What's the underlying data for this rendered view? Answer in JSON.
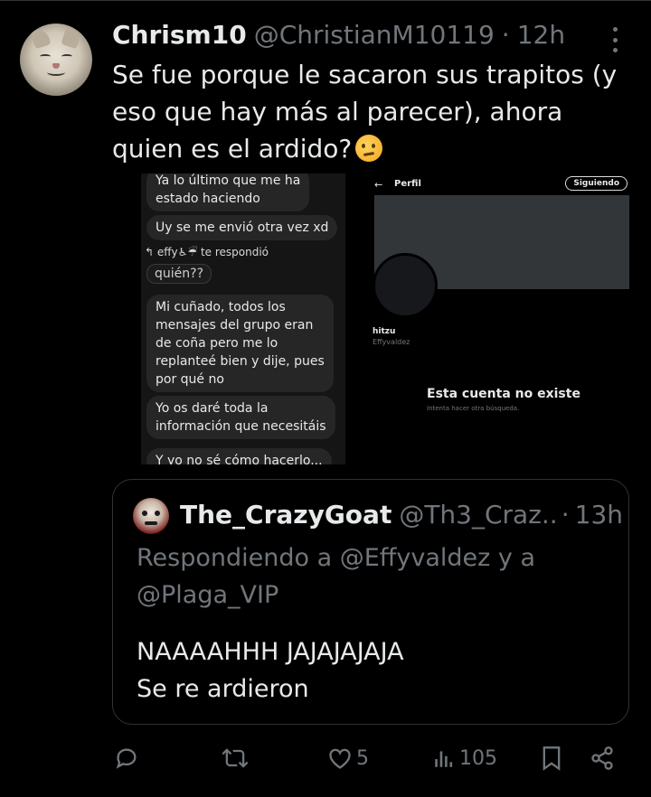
{
  "tweet": {
    "author_name": "Chrism10",
    "author_handle": "@ChristianM10119",
    "separator": "·",
    "time": "12h",
    "text": "Se fue porque le sacaron sus trapitos (y eso que hay más al parecer), ahora quien es el ardido?",
    "emoji": "thinking-face"
  },
  "media_left": {
    "bubble1": "Ya lo último que me ha\nestado haciendo",
    "bubble2": "Uy se me envió otra vez xd",
    "reply_line": "↰ effy♿☔ te respondió",
    "quoted": "quién??",
    "bubble3": "Mi cuñado, todos los\nmensajes del grupo eran\nde coña pero me lo\nreplanteé bien y dije, pues\npor qué no",
    "bubble4": "Yo os daré toda la\ninformación que necesitáis",
    "bubble5": "Y yo no sé cómo hacerlo..."
  },
  "media_right": {
    "back": "←",
    "title": "Perfil",
    "follow_button": "Siguiendo",
    "name": "hitzu",
    "handle": "Effyvaldez",
    "no_exist": "Esta cuenta no existe",
    "try_search": "Intenta hacer otra búsqueda."
  },
  "quote": {
    "author_name": "The_CrazyGoat",
    "author_handle": "@Th3_Craz...",
    "separator": "·",
    "time": "13h",
    "replying_to": "Respondiendo a @Effyvaldez y a @Plaga_VIP",
    "text": "NAAAAHHH JAJAJAJAJA\nSe re ardieron"
  },
  "actions": {
    "reply_count": "",
    "retweet_count": "",
    "like_count": "5",
    "views_count": "105"
  },
  "colors": {
    "background": "#000000",
    "text": "#e7e9ea",
    "muted": "#71767b",
    "border": "#2f3336"
  }
}
